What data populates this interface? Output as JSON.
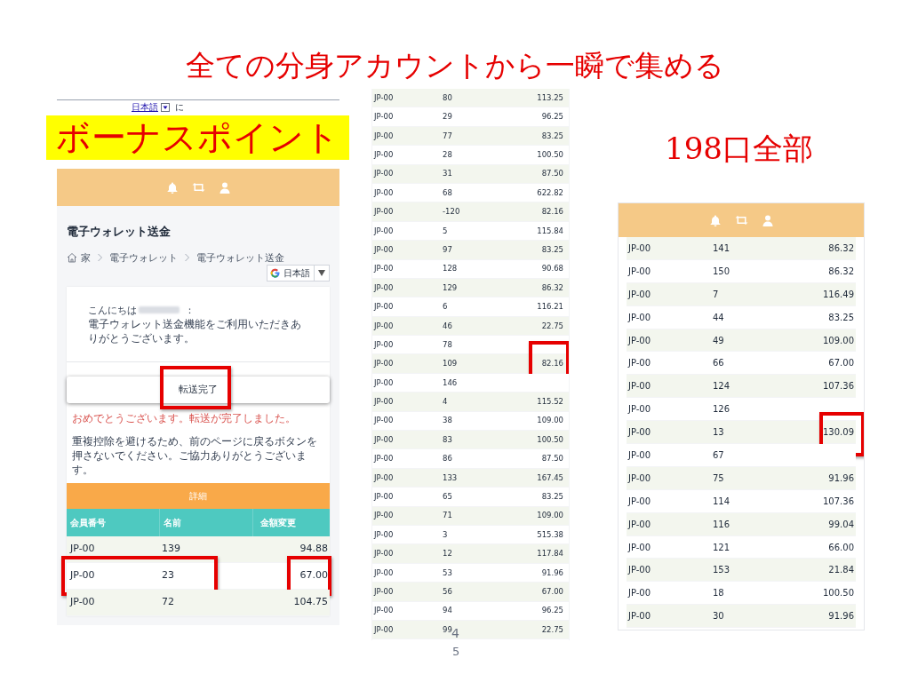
{
  "slide_title": "全ての分身アカウントから一瞬で集める",
  "left_screen": {
    "translate_bar": {
      "language_link": "日本語",
      "suffix": "に"
    },
    "label": "ボーナスポイント",
    "page_title": "電子ウォレット送金",
    "breadcrumb": [
      "家",
      "電子ウォレット",
      "電子ウォレット送金"
    ],
    "language_select": "日本語",
    "greeting_prefix": "こんにちは",
    "greeting_suffix": "：",
    "message": "電子ウォレット送金機能をご利用いただきありがとうございます。",
    "button": {
      "label": "転送完了",
      "boxed": true
    },
    "success_message": "おめでとうございます。転送が完了しました。",
    "notice": "重複控除を避けるため、前のページに戻るボタンを押さないでください。ご協力ありがとうございます。",
    "details_title": "詳細",
    "columns": [
      "会員番号",
      "名前",
      "金額変更"
    ],
    "rows": [
      {
        "member": "JP-00",
        "name": "139",
        "amount": "94.88",
        "boxed_member": false,
        "boxed_amount": false
      },
      {
        "member": "JP-00",
        "name": "23",
        "amount": "67.00",
        "boxed_member": true,
        "boxed_amount": true
      },
      {
        "member": "JP-00",
        "name": "72",
        "amount": "104.75",
        "boxed_member": false,
        "boxed_amount": false
      }
    ]
  },
  "middle_list": {
    "rows": [
      {
        "member": "JP-00",
        "name": "80",
        "amount": "113.25",
        "boxed_amount": false
      },
      {
        "member": "JP-00",
        "name": "29",
        "amount": "96.25",
        "boxed_amount": false
      },
      {
        "member": "JP-00",
        "name": "77",
        "amount": "83.25",
        "boxed_amount": false
      },
      {
        "member": "JP-00",
        "name": "28",
        "amount": "100.50",
        "boxed_amount": false
      },
      {
        "member": "JP-00",
        "name": "31",
        "amount": "87.50",
        "boxed_amount": false
      },
      {
        "member": "JP-00",
        "name": "68",
        "amount": "622.82",
        "boxed_amount": false
      },
      {
        "member": "JP-00",
        "name": "-120",
        "amount": "82.16",
        "boxed_amount": false
      },
      {
        "member": "JP-00",
        "name": "5",
        "amount": "115.84",
        "boxed_amount": false
      },
      {
        "member": "JP-00",
        "name": "97",
        "amount": "83.25",
        "boxed_amount": false
      },
      {
        "member": "JP-00",
        "name": "128",
        "amount": "90.68",
        "boxed_amount": false
      },
      {
        "member": "JP-00",
        "name": "129",
        "amount": "86.32",
        "boxed_amount": false
      },
      {
        "member": "JP-00",
        "name": "6",
        "amount": "116.21",
        "boxed_amount": false
      },
      {
        "member": "JP-00",
        "name": "46",
        "amount": "22.75",
        "boxed_amount": false
      },
      {
        "member": "JP-00",
        "name": "78",
        "boxed_amount": false
      },
      {
        "member": "JP-00",
        "name": "109",
        "amount": "82.16",
        "boxed_amount": true
      },
      {
        "member": "JP-00",
        "name": "146",
        "boxed_amount": false
      },
      {
        "member": "JP-00",
        "name": "4",
        "amount": "115.52",
        "boxed_amount": false
      },
      {
        "member": "JP-00",
        "name": "38",
        "amount": "109.00",
        "boxed_amount": false
      },
      {
        "member": "JP-00",
        "name": "83",
        "amount": "100.50",
        "boxed_amount": false
      },
      {
        "member": "JP-00",
        "name": "86",
        "amount": "87.50",
        "boxed_amount": false
      },
      {
        "member": "JP-00",
        "name": "133",
        "amount": "167.45",
        "boxed_amount": false
      },
      {
        "member": "JP-00",
        "name": "65",
        "amount": "83.25",
        "boxed_amount": false
      },
      {
        "member": "JP-00",
        "name": "71",
        "amount": "109.00",
        "boxed_amount": false
      },
      {
        "member": "JP-00",
        "name": "3",
        "amount": "515.38",
        "boxed_amount": false
      },
      {
        "member": "JP-00",
        "name": "12",
        "amount": "117.84",
        "boxed_amount": false
      },
      {
        "member": "JP-00",
        "name": "53",
        "amount": "91.96",
        "boxed_amount": false
      },
      {
        "member": "JP-00",
        "name": "56",
        "amount": "67.00",
        "boxed_amount": false
      },
      {
        "member": "JP-00",
        "name": "94",
        "amount": "96.25",
        "boxed_amount": false
      },
      {
        "member": "JP-00",
        "name": "99",
        "amount": "22.75",
        "boxed_amount": false
      }
    ]
  },
  "slide_number_overlay": "4",
  "total_label": "198口全部",
  "right_list": {
    "rows": [
      {
        "member": "JP-00",
        "name": "141",
        "amount": "86.32",
        "boxed_amount": false
      },
      {
        "member": "JP-00",
        "name": "150",
        "amount": "86.32",
        "boxed_amount": false
      },
      {
        "member": "JP-00",
        "name": "7",
        "amount": "116.49",
        "boxed_amount": false
      },
      {
        "member": "JP-00",
        "name": "44",
        "amount": "83.25",
        "boxed_amount": false
      },
      {
        "member": "JP-00",
        "name": "49",
        "amount": "109.00",
        "boxed_amount": false
      },
      {
        "member": "JP-00",
        "name": "66",
        "amount": "67.00",
        "boxed_amount": false
      },
      {
        "member": "JP-00",
        "name": "124",
        "amount": "107.36",
        "boxed_amount": false
      },
      {
        "member": "JP-00",
        "name": "126",
        "boxed_amount": false
      },
      {
        "member": "JP-00",
        "name": "13",
        "amount": "130.09",
        "boxed_amount": true
      },
      {
        "member": "JP-00",
        "name": "67",
        "boxed_amount": false
      },
      {
        "member": "JP-00",
        "name": "75",
        "amount": "91.96",
        "boxed_amount": false
      },
      {
        "member": "JP-00",
        "name": "114",
        "amount": "107.36",
        "boxed_amount": false
      },
      {
        "member": "JP-00",
        "name": "116",
        "amount": "99.04",
        "boxed_amount": false
      },
      {
        "member": "JP-00",
        "name": "121",
        "amount": "66.00",
        "boxed_amount": false
      },
      {
        "member": "JP-00",
        "name": "153",
        "amount": "21.84",
        "boxed_amount": false
      },
      {
        "member": "JP-00",
        "name": "18",
        "amount": "100.50",
        "boxed_amount": false
      },
      {
        "member": "JP-00",
        "name": "30",
        "amount": "91.96",
        "boxed_amount": false
      }
    ]
  },
  "page_number": "5"
}
